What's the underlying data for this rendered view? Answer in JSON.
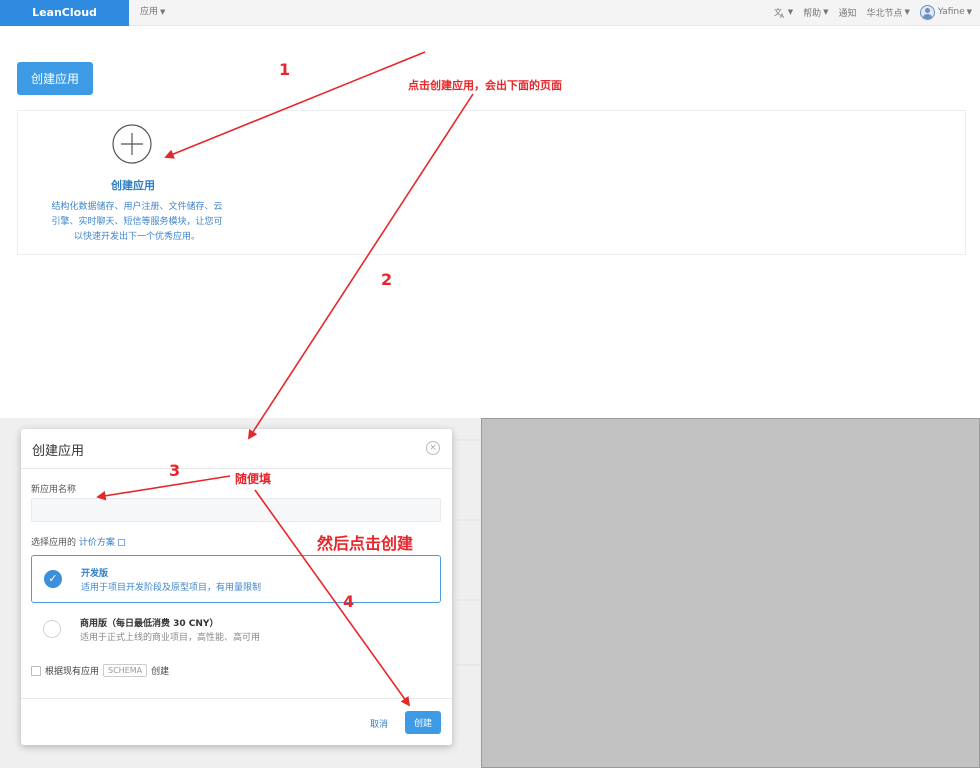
{
  "navbar": {
    "brand": "LeanCloud",
    "apps_menu": "应用",
    "right_items": [
      {
        "label": "",
        "icon": "translate-icon"
      },
      {
        "label": "帮助"
      },
      {
        "label": "通知"
      },
      {
        "label": "华北节点"
      },
      {
        "label": "Yafine",
        "icon": "user-avatar-icon"
      }
    ]
  },
  "main": {
    "create_button": "创建应用",
    "card": {
      "icon": "plus-circle-icon",
      "title": "创建应用",
      "description_lines": [
        "结构化数据储存、用户注册、文件储存、云",
        "引擎、实时聊天、短信等服务模块，让您可",
        "以快速开发出下一个优秀应用。"
      ]
    }
  },
  "annotations": {
    "step1": "1",
    "step2": "2",
    "step3": "3",
    "step4": "4",
    "note_click_create": "点击创建应用，会出下面的页面",
    "note_fill": "随便填",
    "note_then_click": "然后点击创建",
    "color": "#e7262b"
  },
  "modal": {
    "title": "创建应用",
    "name_label": "新应用名称",
    "name_value": "",
    "plan_label": "选择应用的",
    "plan_link": "计价方案",
    "plans": [
      {
        "name": "开发版",
        "desc": "适用于项目开发阶段及原型项目，有用量限制",
        "selected": true
      },
      {
        "name": "商用版（每日最低消费 30 CNY）",
        "desc": "适用于正式上线的商业项目，高性能、高可用",
        "selected": false
      }
    ],
    "schema_prefix": "根据现有应用",
    "schema_tag": "SCHEMA",
    "schema_suffix": "创建",
    "cancel": "取消",
    "submit": "创建"
  },
  "colors": {
    "brand": "#2f8be0",
    "primary": "#3d9be6",
    "link": "#2f7fc6"
  }
}
